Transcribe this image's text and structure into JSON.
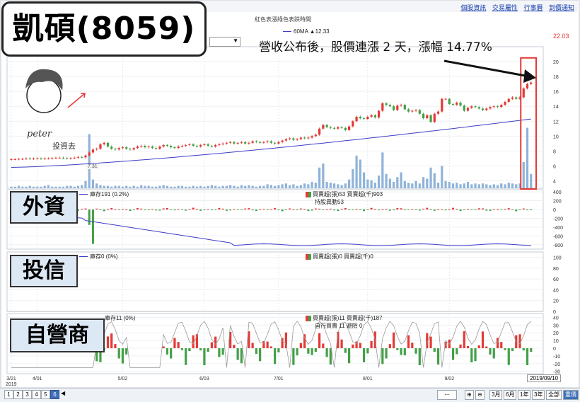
{
  "stock_title": "凱碩(8059)",
  "headline": "營收公布後，股價連漲 2 天，漲幅 14.77%",
  "top_links": [
    "個股資訊",
    "交易屬性",
    "行事曆",
    "到價通知"
  ],
  "chart_header": "紅色表漲綠色表跌時間",
  "ma_label": "60MA ▲12.33",
  "last_price": "22.03",
  "watermark_name": "peter",
  "watermark_caption": "投資去",
  "low_price_marker": "7.31",
  "panels": {
    "foreign": {
      "label": "外資",
      "legend_line": "庫存191 (0.2%)",
      "legend_bar": "買賣超(張)53 買賣超(千)903",
      "legend_extra": "持股異動53"
    },
    "trust": {
      "label": "投信",
      "legend_line": "庫存0 (0%)",
      "legend_bar": "買賣超(張)0 買賣超(千)0",
      "legend_extra": ""
    },
    "dealer": {
      "label": "自營商",
      "legend_line": "庫存11 (0%)",
      "legend_bar": "買賣超(張)11 買賣超(千)187",
      "legend_extra": "自行買賣 11 避險 0"
    }
  },
  "date_box": "2019/09/10",
  "x_year": "2019",
  "pager": {
    "pages": [
      "1",
      "2",
      "3",
      "4",
      "5",
      "6"
    ],
    "active": "6"
  },
  "range_buttons": [
    "3月",
    "6月",
    "1年",
    "3年",
    "全部",
    "重價"
  ],
  "colors": {
    "up": "#e53935",
    "down": "#43a047",
    "ma": "#3d3dc8",
    "volume": "#8fb3d9",
    "highlight": "#e53935"
  },
  "chart_data": [
    {
      "type": "candlestick",
      "x_tick_labels": [
        "3/21",
        "4/01",
        "5/02",
        "6/03",
        "7/01",
        "8/01",
        "9/02"
      ],
      "y_tick_labels": [
        4,
        6,
        8,
        10,
        12,
        14,
        16,
        18,
        20
      ],
      "ylim": [
        3,
        22
      ],
      "series_close": [
        6.9,
        6.9,
        6.95,
        6.95,
        7.0,
        6.95,
        7.0,
        7.0,
        6.95,
        7.0,
        7.0,
        7.05,
        7.1,
        7.1,
        7.05,
        7.0,
        7.05,
        7.1,
        7.2,
        7.15,
        7.4,
        7.8,
        8.2,
        8.3,
        8.9,
        9.1,
        8.6,
        8.3,
        8.2,
        8.4,
        8.5,
        8.3,
        8.2,
        8.4,
        8.6,
        8.7,
        8.5,
        8.6,
        8.4,
        8.3,
        8.6,
        8.8,
        8.7,
        8.5,
        8.4,
        8.6,
        8.7,
        8.8,
        8.9,
        8.7,
        8.6,
        8.8,
        8.9,
        8.7,
        8.6,
        8.8,
        8.9,
        9.0,
        9.1,
        9.2,
        9.0,
        9.1,
        9.2,
        9.0,
        9.1,
        9.3,
        9.2,
        9.1,
        9.2,
        9.3,
        9.1,
        9.0,
        9.2,
        9.4,
        9.6,
        9.7,
        9.5,
        9.6,
        9.8,
        9.7,
        9.8,
        10.0,
        10.2,
        11.0,
        11.5,
        11.2,
        11.1,
        11.0,
        11.2,
        11.1,
        10.8,
        11.3,
        12.0,
        12.6,
        12.4,
        12.3,
        12.6,
        12.8,
        12.5,
        13.4,
        14.4,
        14.2,
        14.0,
        13.5,
        14.1,
        14.2,
        13.6,
        13.3,
        13.4,
        13.5,
        13.0,
        12.4,
        12.8,
        11.9,
        13.0,
        13.3,
        15.0,
        15.0,
        14.3,
        14.2,
        14.5,
        14.1,
        13.4,
        13.8,
        14.0,
        13.9,
        13.7,
        13.5,
        13.7,
        13.9,
        14.0,
        13.9,
        14.2,
        14.6,
        15.0,
        15.2,
        15.0,
        15.2,
        16.4,
        17.0,
        17.2
      ],
      "ma_line": {
        "name": "60MA",
        "start": 5.8,
        "end": 12.3
      },
      "volume": [
        0.2,
        0.2,
        0.3,
        0.2,
        0.2,
        0.3,
        0.2,
        0.2,
        0.2,
        0.3,
        0.4,
        0.2,
        0.2,
        0.2,
        0.2,
        0.3,
        0.3,
        0.2,
        0.3,
        0.4,
        0.9,
        6.8,
        1.1,
        0.6,
        0.4,
        0.3,
        0.3,
        0.2,
        0.3,
        0.3,
        0.2,
        0.3,
        0.2,
        0.3,
        0.2,
        0.4,
        0.3,
        0.3,
        0.2,
        0.2,
        0.3,
        0.4,
        0.3,
        0.2,
        0.2,
        0.3,
        0.3,
        0.2,
        0.2,
        0.3,
        0.2,
        0.3,
        0.2,
        0.3,
        0.4,
        0.3,
        0.2,
        0.3,
        0.3,
        0.4,
        0.3,
        0.2,
        0.4,
        0.3,
        0.4,
        0.3,
        0.2,
        0.3,
        0.3,
        0.5,
        0.4,
        0.3,
        0.4,
        0.5,
        0.6,
        0.4,
        0.5,
        0.3,
        0.4,
        0.6,
        0.5,
        0.8,
        0.7,
        2.6,
        3.1,
        0.8,
        0.7,
        0.6,
        0.5,
        0.4,
        0.6,
        1.1,
        2.4,
        4.1,
        3.6,
        2.0,
        1.1,
        1.0,
        0.7,
        1.6,
        4.5,
        1.8,
        1.2,
        0.8,
        1.4,
        2.0,
        0.9,
        0.7,
        0.6,
        0.9,
        0.6,
        1.4,
        1.2,
        2.6,
        1.9,
        0.7,
        2.8,
        0.9,
        0.8,
        0.6,
        0.7,
        0.5,
        0.6,
        0.8,
        0.5,
        0.6,
        0.5,
        0.6,
        0.5,
        0.4,
        0.5,
        0.4,
        0.6,
        0.5,
        0.7,
        0.6,
        0.5,
        0.6,
        3.3,
        7.6,
        1.8
      ]
    },
    {
      "type": "bar",
      "name": "外資",
      "y_tick_labels": [
        400,
        200,
        0,
        -200,
        -400,
        -600,
        -800
      ],
      "ylim": [
        -900,
        450
      ]
    },
    {
      "type": "bar",
      "name": "投信",
      "y_tick_labels": [
        100,
        80,
        60,
        40,
        20,
        0
      ],
      "ylim": [
        0,
        110
      ]
    },
    {
      "type": "bar",
      "name": "自營商",
      "y_tick_labels": [
        40,
        30,
        20,
        10,
        0,
        -10,
        -20,
        -30
      ],
      "ylim": [
        -33,
        45
      ]
    }
  ]
}
